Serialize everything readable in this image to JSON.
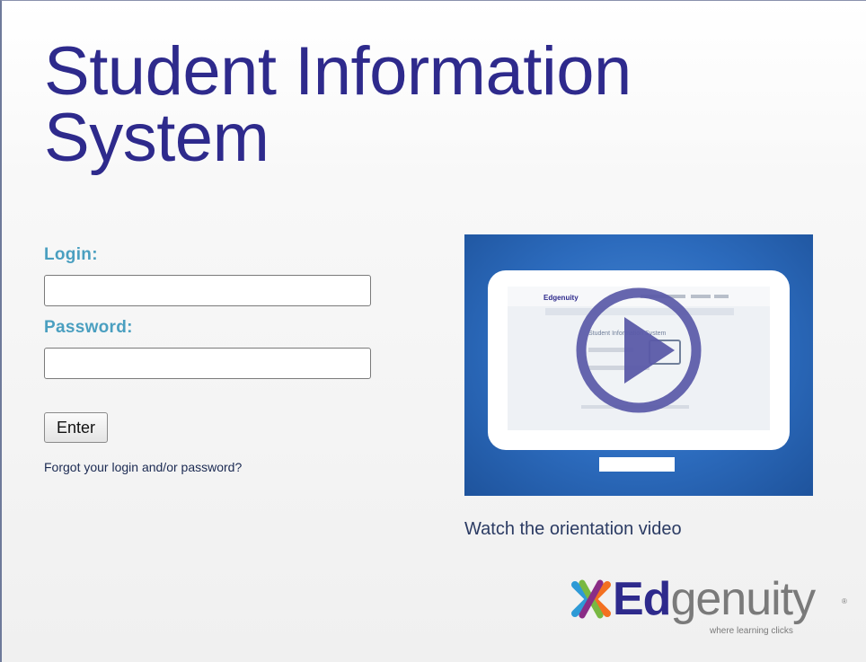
{
  "page": {
    "title_line1": "Student Information",
    "title_line2": "System"
  },
  "login_form": {
    "login_label": "Login:",
    "login_value": "",
    "password_label": "Password:",
    "password_value": "",
    "enter_label": "Enter",
    "forgot_link": "Forgot your login and/or password?"
  },
  "video": {
    "thumbnail_icon": "play-icon",
    "caption": "Watch the orientation video",
    "screen_brand": "Edgenuity",
    "screen_heading": "Student Information System"
  },
  "brand": {
    "logo_prefix": "Ed",
    "logo_suffix": "genuity",
    "trademark": "®",
    "tagline": "where learning clicks",
    "colors": {
      "title": "#2e2a8c",
      "label": "#4a9fc0",
      "logo_blue": "#2e2a8c",
      "logo_gray": "#7a7a7a"
    }
  }
}
